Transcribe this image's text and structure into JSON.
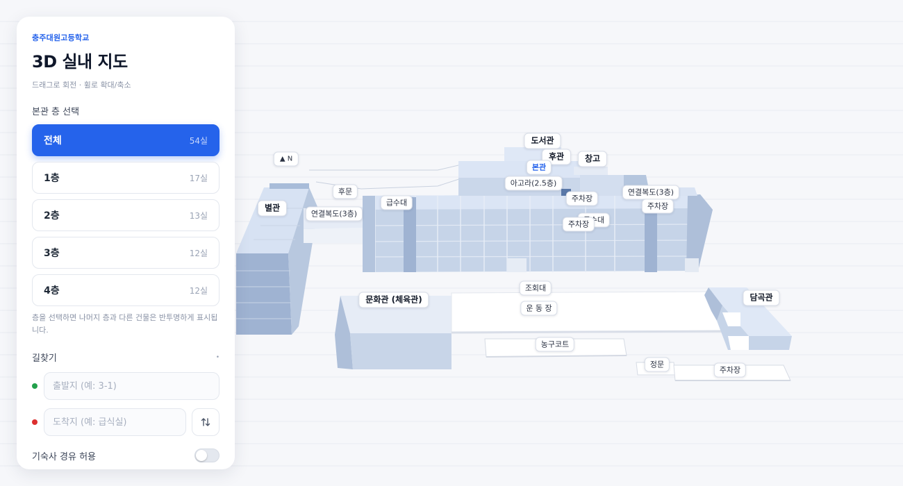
{
  "panel": {
    "school": "충주대원고등학교",
    "title": "3D 실내 지도",
    "hint": "드래그로 회전 · 휠로 확대/축소",
    "floor_section": "본관 층 선택",
    "floors": [
      {
        "label": "전체",
        "count": "54실",
        "active": true
      },
      {
        "label": "1층",
        "count": "17실",
        "active": false
      },
      {
        "label": "2층",
        "count": "13실",
        "active": false
      },
      {
        "label": "3층",
        "count": "12실",
        "active": false
      },
      {
        "label": "4층",
        "count": "12실",
        "active": false
      }
    ],
    "floor_note": "층을 선택하면 나머지 층과 다른 건물은 반투명하게 표시됩니다.",
    "route": {
      "title": "길찾기",
      "marker": "•",
      "start_placeholder": "출발지 (예: 3-1)",
      "end_placeholder": "도착지 (예: 급식실)",
      "start_value": "",
      "end_value": "",
      "swap_icon": "swap-vertical-icon"
    },
    "dorm_toggle": {
      "label": "기숙사 경유 허용",
      "on": false
    }
  },
  "map": {
    "compass": "▲ N",
    "labels": {
      "library": "도서관",
      "back_building": "후관",
      "main_building": "본관",
      "warehouse": "창고",
      "agora": "아고라(2.5층)",
      "annex": "별관",
      "back_gate": "후문",
      "corridor_left": "연결복도(3층)",
      "water_station": "급수대",
      "parking_1": "주차장",
      "corridor_right": "연결복도(3층)",
      "parking_2": "주차장",
      "water_station_2": "급수대",
      "parking_3": "주차장",
      "culture_hall": "문화관 (체육관)",
      "podium": "조회대",
      "playground": "운 동 장",
      "damgok_hall": "담곡관",
      "basketball": "농구코트",
      "main_gate": "정문",
      "parking_4": "주차장"
    }
  },
  "colors": {
    "accent": "#2563eb",
    "building_top": "#dce6f7",
    "building_side": "#b9c8df",
    "building_dark": "#8fa6c7"
  }
}
